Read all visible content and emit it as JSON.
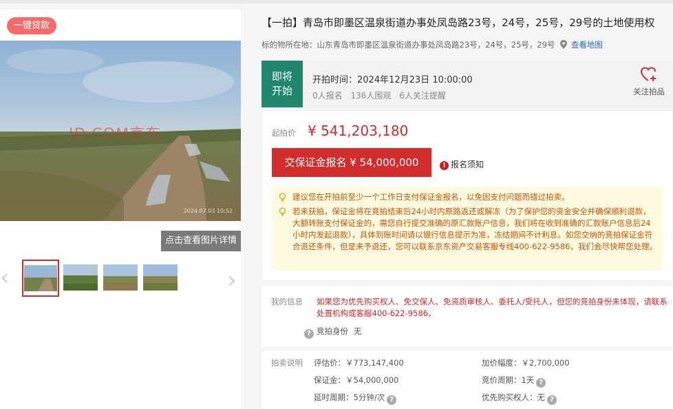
{
  "gallery": {
    "loan_badge": "一键贷款",
    "watermark": "JD.COM京东",
    "timestamp": "2024.07.03 10:52",
    "detail_button": "点击查看图片详情",
    "thumbnails": [
      "thumb-1",
      "thumb-2",
      "thumb-3",
      "thumb-4"
    ],
    "prev_icon": "chevron-left-icon",
    "next_icon": "chevron-right-icon"
  },
  "header": {
    "title": "【一拍】青岛市即墨区温泉街道办事处凤岛路23号，24号，25号，29号的土地使用权",
    "location_label": "标的物所在地：",
    "location": "山东青岛市即墨区温泉街道办事处凤岛路23号，24号，25号，29号",
    "map_link": "查看地图",
    "pin_icon": "location-pin-icon"
  },
  "status": {
    "badge_line1": "即将",
    "badge_line2": "开始",
    "start_time_label": "开拍时间：",
    "start_time": "2024年12月23日 10:00:00",
    "signups": "0人报名",
    "watchers": "136人围观",
    "reminders": "6人关注提醒",
    "follow_label": "关注拍品",
    "follow_icon": "heart-plus-icon"
  },
  "bid": {
    "start_label": "起拍价",
    "start_price": "¥ 541,203,180",
    "deposit_button": "交保证金报名 ¥ 54,000,000",
    "notice_link": "报名须知",
    "tips": [
      "建议您在开拍前至少一个工作日支付保证金报名，以免因支付问题而错过拍卖。",
      "若未获拍，保证金将在竞拍结束后24小时内原路返还或解冻（为了保护您的资金安全并确保顺利退款，大额转账支付保证金的，需您自行提交准确的原汇款账户信息，我们将在收到准确的汇款账户信息后24小时内发起退款），具体到账时间请以银行信息提示为准，冻结期间不计利息。如您交纳的竞拍保证金符合退还条件，但是未予退还，您可以联系京东资产交易客服专线400-622-9586，我们会尽快帮您处理。"
    ],
    "tip_icon": "lightbulb-icon"
  },
  "my_info": {
    "label": "我的信息",
    "warning": "如果您为优先购买权人、免交保人、免资质审核人、委托人/受托人，但您的竞拍身份未体现，请联系处置机构或客服400-622-9586。",
    "role_label": "竞拍身份",
    "role_value": "无"
  },
  "auction_info": {
    "label": "拍卖说明",
    "appraisal": "评估价：￥773,147,400",
    "increment": "加价幅度：￥2,700,000",
    "deposit": "保证金：￥54,000,000",
    "cycle": "竞价周期：1天",
    "extension": "延时周期：5分钟/次",
    "priority": "优先购买权人：无"
  },
  "colors": {
    "accent_red": "#d12d2d",
    "status_green": "#20876c",
    "link_blue": "#2a6ebb",
    "tip_orange": "#c8540a",
    "tip_bg": "#fffbe0"
  }
}
